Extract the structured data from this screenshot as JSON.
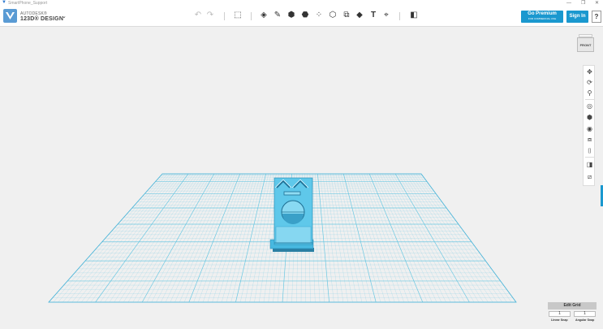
{
  "window": {
    "title": "SmartPhone_Support",
    "minimize_glyph": "—",
    "maximize_glyph": "❐",
    "close_glyph": "✕",
    "app_icon": "autodesk-v-icon"
  },
  "brand": {
    "line1": "AUTODESK®",
    "line2": "123D® DESIGN",
    "menu_caret": "⌄"
  },
  "toolbar": {
    "undo_glyph": "↶",
    "redo_glyph": "↷",
    "tools": [
      {
        "name": "transform-tool-icon",
        "glyph": "⬚"
      },
      {
        "name": "primitives-tool-icon",
        "glyph": "◈"
      },
      {
        "name": "sketch-tool-icon",
        "glyph": "✎"
      },
      {
        "name": "construct-tool-icon",
        "glyph": "⬢"
      },
      {
        "name": "modify-tool-icon",
        "glyph": "⬣"
      },
      {
        "name": "pattern-tool-icon",
        "glyph": "⁘"
      },
      {
        "name": "group-tool-icon",
        "glyph": "⬡"
      },
      {
        "name": "combine-tool-icon",
        "glyph": "⧉"
      },
      {
        "name": "measure-tool-icon",
        "glyph": "◆"
      },
      {
        "name": "text-tool-icon",
        "glyph": "T"
      },
      {
        "name": "snap-tool-icon",
        "glyph": "⌖"
      },
      {
        "name": "material-tool-icon",
        "glyph": "◧"
      }
    ],
    "premium_label": "Go Premium",
    "premium_sub": "FOR COMMERCIAL USE",
    "signin_label": "Sign In",
    "help_label": "?"
  },
  "viewcube": {
    "face_label": "FRONT"
  },
  "navbar": {
    "items": [
      {
        "name": "pan-icon",
        "glyph": "✥"
      },
      {
        "name": "orbit-icon",
        "glyph": "⟳"
      },
      {
        "name": "zoom-icon",
        "glyph": "⚲"
      },
      {
        "name": "fit-icon",
        "glyph": "◎"
      },
      {
        "name": "view-mode-icon",
        "glyph": "⬢"
      },
      {
        "name": "visibility-icon",
        "glyph": "◉"
      },
      {
        "name": "grouping-icon",
        "glyph": "⧈"
      },
      {
        "name": "camera-icon",
        "glyph": "⌷"
      },
      {
        "name": "materials-icon",
        "glyph": "◨"
      },
      {
        "name": "outline-icon",
        "glyph": "⧄"
      }
    ]
  },
  "grid": {
    "edit_label": "Edit Grid",
    "linear_snap_value": "1",
    "angular_snap_value": "1",
    "linear_snap_label": "Linear Snap",
    "angular_snap_label": "Angular Snap"
  },
  "colors": {
    "accent": "#1a98cf",
    "grid_line": "#5ec3e0",
    "model": "#5fc8ea",
    "background": "#f0f0f0"
  }
}
